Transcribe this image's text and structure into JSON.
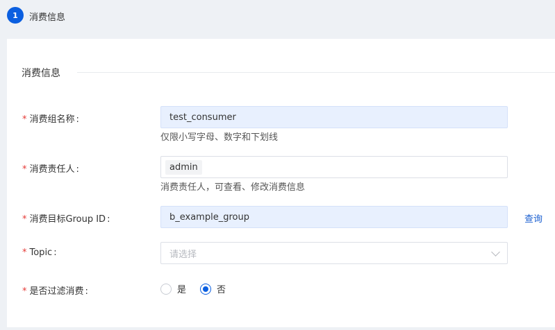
{
  "step": {
    "number": "1",
    "label": "消费信息"
  },
  "section": {
    "title": "消费信息"
  },
  "fields": {
    "group_name": {
      "label": "消费组名称",
      "value": "test_consumer",
      "hint": "仅限小写字母、数字和下划线"
    },
    "owner": {
      "label": "消费责任人",
      "tag": "admin",
      "hint": "消费责任人，可查看、修改消费信息"
    },
    "target_group": {
      "label": "消费目标Group ID",
      "value": "b_example_group",
      "action": "查询"
    },
    "topic": {
      "label": "Topic",
      "placeholder": "请选择"
    },
    "filter": {
      "label": "是否过滤消费",
      "options": [
        "是",
        "否"
      ],
      "selected": "否"
    }
  },
  "required_mark": "*",
  "colon": ":",
  "colors": {
    "accent": "#0b5fe0",
    "required": "#e53935",
    "filled_bg": "#e8f0fe"
  }
}
